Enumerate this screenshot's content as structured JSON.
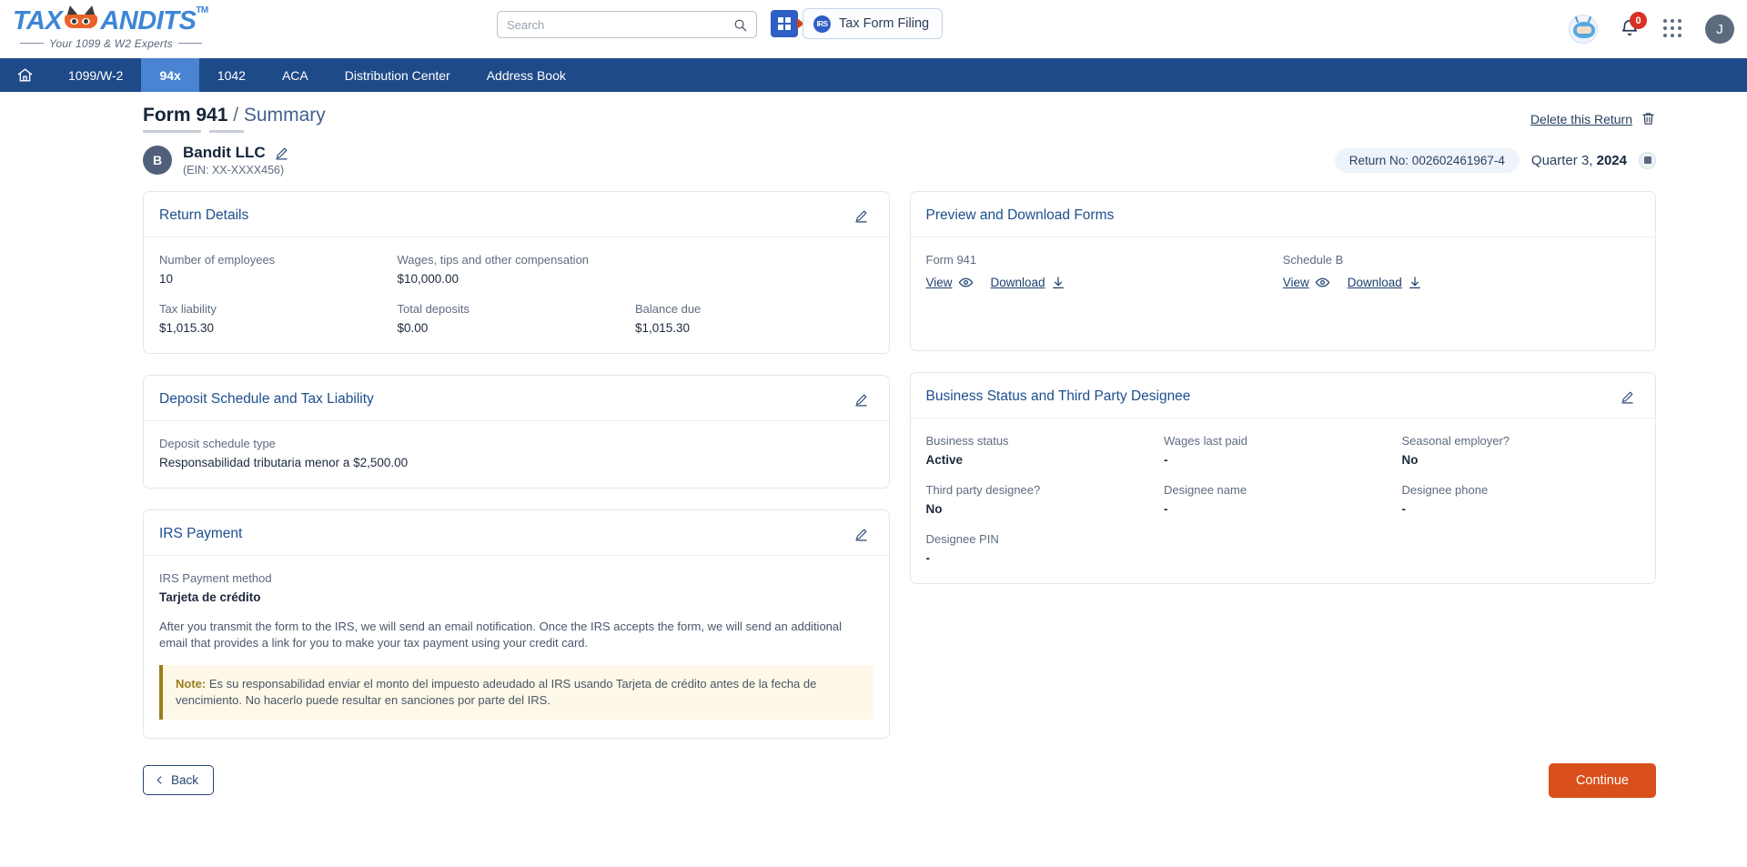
{
  "header": {
    "logo_text": "TAXBANDITS",
    "logo_part1": "TAX",
    "logo_part2": "ANDITS",
    "logo_tm": "TM",
    "logo_tagline": "Your 1099 & W2 Experts",
    "search_placeholder": "Search",
    "search_value": "",
    "tax_form_filing": "Tax Form Filing",
    "notification_count": "0",
    "avatar_initial": "J"
  },
  "nav": {
    "items": [
      {
        "label": "",
        "icon": "home-icon",
        "active": false
      },
      {
        "label": "1099/W-2",
        "active": false
      },
      {
        "label": "94x",
        "active": true
      },
      {
        "label": "1042",
        "active": false
      },
      {
        "label": "ACA",
        "active": false
      },
      {
        "label": "Distribution Center",
        "active": false
      },
      {
        "label": "Address Book",
        "active": false
      }
    ]
  },
  "breadcrumb": {
    "form": "Form 941",
    "separator": "/",
    "page": "Summary"
  },
  "delete_return": {
    "label": "Delete this Return"
  },
  "business": {
    "avatar_initial": "B",
    "name": "Bandit LLC",
    "ein": "(EIN: XX-XXXX456)",
    "return_no": "Return No: 002602461967-4",
    "quarter_prefix": "Quarter 3, ",
    "quarter_year": "2024"
  },
  "return_details": {
    "title": "Return Details",
    "fields": [
      {
        "label": "Number of employees",
        "value": "10"
      },
      {
        "label": "Wages, tips and other compensation",
        "value": "$10,000.00"
      },
      {
        "label": "",
        "value": ""
      },
      {
        "label": "Tax liability",
        "value": "$1,015.30"
      },
      {
        "label": "Total deposits",
        "value": "$0.00"
      },
      {
        "label": "Balance due",
        "value": "$1,015.30"
      }
    ]
  },
  "preview_download": {
    "title": "Preview and Download Forms",
    "forms": [
      {
        "name": "Form 941",
        "view": "View",
        "download": "Download"
      },
      {
        "name": "Schedule B",
        "view": "View",
        "download": "Download"
      }
    ]
  },
  "deposit_schedule": {
    "title": "Deposit Schedule and Tax Liability",
    "label": "Deposit schedule type",
    "value": "Responsabilidad tributaria menor a $2,500.00"
  },
  "business_status": {
    "title": "Business Status and Third Party Designee",
    "fields": [
      {
        "label": "Business status",
        "value": "Active"
      },
      {
        "label": "Wages last paid",
        "value": "-"
      },
      {
        "label": "Seasonal employer?",
        "value": "No"
      },
      {
        "label": "Third party designee?",
        "value": "No"
      },
      {
        "label": "Designee name",
        "value": "-"
      },
      {
        "label": "Designee phone",
        "value": "-"
      },
      {
        "label": "Designee PIN",
        "value": "-"
      }
    ]
  },
  "irs_payment": {
    "title": "IRS Payment",
    "method_label": "IRS Payment method",
    "method_value": "Tarjeta de crédito",
    "description": "After you transmit the form to the IRS, we will send an email notification. Once the IRS accepts the form, we will send an additional email that provides a link for you to make your tax payment using your credit card.",
    "note_label": "Note:",
    "note_text": " Es su responsabilidad enviar el monto del impuesto adeudado al IRS usando Tarjeta de crédito antes de la fecha de vencimiento. No hacerlo puede resultar en sanciones por parte del IRS."
  },
  "footer": {
    "back": "Back",
    "continue": "Continue"
  },
  "colors": {
    "nav_blue": "#1f4a89",
    "nav_active": "#4a83d2",
    "accent_orange": "#d9501c",
    "title_blue": "#1d4e8f",
    "note_gold": "#9b7d1d"
  }
}
